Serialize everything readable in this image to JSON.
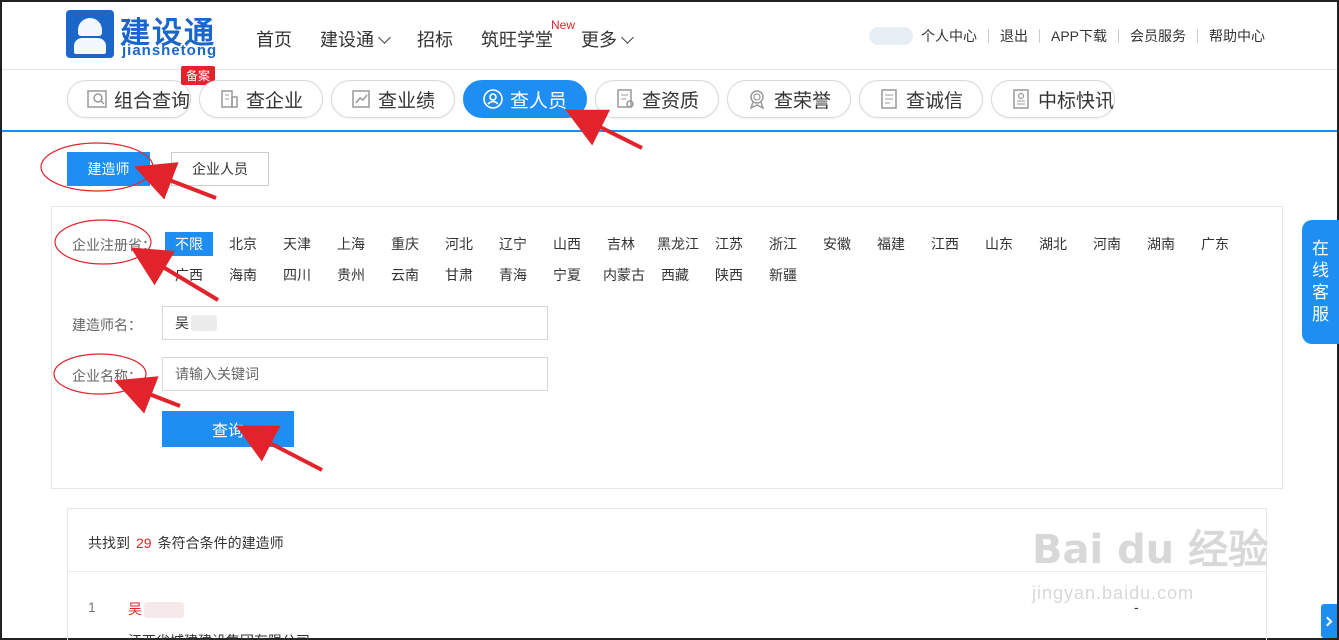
{
  "logo": {
    "cn": "建设通",
    "en": "jianshetong"
  },
  "nav": {
    "items": [
      {
        "label": "首页",
        "chevron": false
      },
      {
        "label": "建设通",
        "chevron": true
      },
      {
        "label": "招标",
        "chevron": false
      },
      {
        "label": "筑旺学堂",
        "chevron": false,
        "badge": "New"
      },
      {
        "label": "更多",
        "chevron": true
      }
    ]
  },
  "top_links": [
    "个人中心",
    "退出",
    "APP下载",
    "会员服务",
    "帮助中心"
  ],
  "tabs": {
    "badge": "备案",
    "items": [
      {
        "label": "组合查询",
        "icon": "search-combo-icon"
      },
      {
        "label": "查企业",
        "icon": "building-icon"
      },
      {
        "label": "查业绩",
        "icon": "chart-icon"
      },
      {
        "label": "查人员",
        "icon": "person-icon",
        "active": true
      },
      {
        "label": "查资质",
        "icon": "certificate-icon"
      },
      {
        "label": "查荣誉",
        "icon": "medal-icon"
      },
      {
        "label": "查诚信",
        "icon": "document-icon"
      },
      {
        "label": "中标快讯",
        "icon": "news-icon"
      }
    ]
  },
  "subtabs": {
    "primary": "建造师",
    "secondary": "企业人员"
  },
  "filter": {
    "province_label": "企业注册省：",
    "provinces": [
      "不限",
      "北京",
      "天津",
      "上海",
      "重庆",
      "河北",
      "辽宁",
      "山西",
      "吉林",
      "黑龙江",
      "江苏",
      "浙江",
      "安徽",
      "福建",
      "江西",
      "山东",
      "湖北",
      "河南",
      "湖南",
      "广东",
      "广西",
      "海南",
      "四川",
      "贵州",
      "云南",
      "甘肃",
      "青海",
      "宁夏",
      "内蒙古",
      "西藏",
      "陕西",
      "新疆"
    ],
    "selected_province": "不限",
    "builder_label": "建造师名：",
    "builder_value": "吴",
    "company_label": "企业名称：",
    "company_placeholder": "请输入关键词",
    "query_button": "查询"
  },
  "results": {
    "prefix": "共找到",
    "count": "29",
    "suffix": "条符合条件的建造师",
    "rows": [
      {
        "index": "1",
        "name": "吴",
        "company": "江西省城建建设集团有限公司",
        "extra": "-"
      }
    ]
  },
  "side": {
    "chat_label": [
      "在",
      "线",
      "客",
      "服"
    ]
  },
  "watermark": {
    "main": "Bai du 经验",
    "sub": "jingyan.baidu.com"
  },
  "colors": {
    "accent": "#1e8ef2",
    "brand": "#1a66c9",
    "highlight": "#e3232c"
  }
}
